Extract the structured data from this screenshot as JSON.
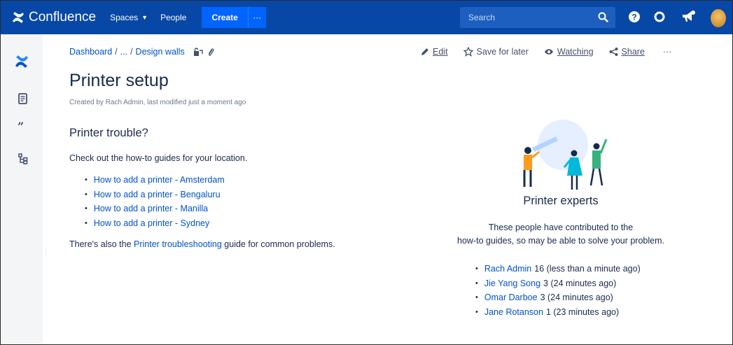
{
  "app": {
    "name": "Confluence"
  },
  "topnav": {
    "spaces": "Spaces",
    "people": "People",
    "create": "Create",
    "more": "···",
    "search_placeholder": "Search",
    "colors": {
      "bar": "#0747a6",
      "create": "#0065ff"
    }
  },
  "breadcrumb": {
    "home": "Dashboard",
    "sep1": "/",
    "ellipsis": "...",
    "sep2": "/",
    "current": "Design walls"
  },
  "actions": {
    "edit": "Edit",
    "save": "Save for later",
    "watch": "Watching",
    "share": "Share",
    "more": "···"
  },
  "page": {
    "title": "Printer setup",
    "byline": "Created by Rach Admin, last modified just a moment ago",
    "heading": "Printer trouble?",
    "intro": "Check out the how-to guides for your location.",
    "links": [
      "How to add a printer - Amsterdam",
      "How to add a printer - Bengaluru",
      "How to add a printer - Manilla",
      "How to add a printer - Sydney"
    ],
    "outro_before": "There's also the ",
    "outro_link": "Printer troubleshooting",
    "outro_after": " guide for common problems."
  },
  "panel": {
    "title": "Printer experts",
    "description_line1": "These people have contributed to the",
    "description_line2": "how-to guides, so may be able to solve your problem.",
    "experts": [
      {
        "name": "Rach Admin",
        "detail": "16 (less than a minute ago)"
      },
      {
        "name": "Jie Yang Song",
        "detail": "3 (24 minutes ago)"
      },
      {
        "name": "Omar Darboe",
        "detail": "3 (24 minutes ago)"
      },
      {
        "name": "Jane Rotanson",
        "detail": "1 (23 minutes ago)"
      }
    ]
  },
  "icons": {
    "logo": "confluence-logo-icon",
    "search": "search-icon",
    "help": "help-icon",
    "settings": "gear-icon",
    "notifications": "megaphone-icon",
    "rail": [
      "confluence-space-icon",
      "pages-icon",
      "blog-quote-icon",
      "page-tree-icon"
    ]
  }
}
